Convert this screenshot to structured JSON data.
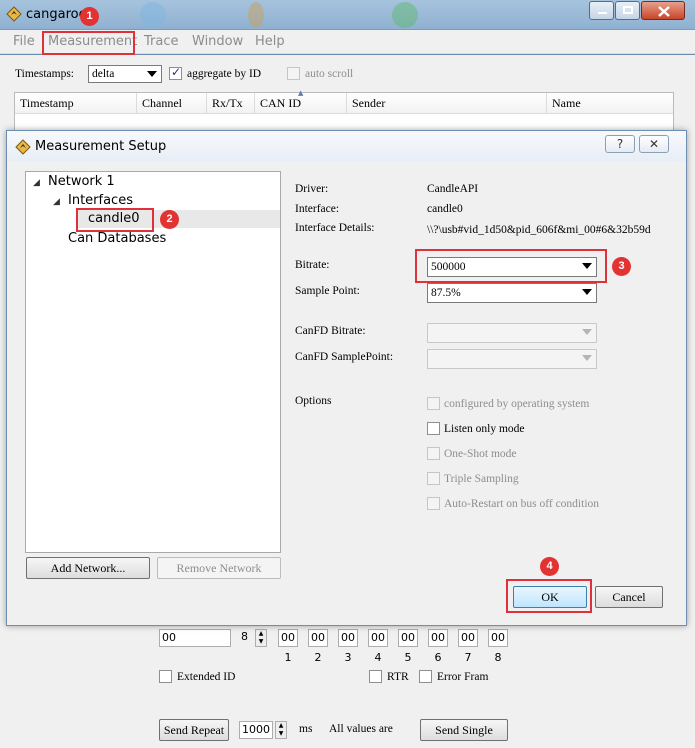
{
  "main": {
    "title": "cangaroo",
    "menu": [
      "File",
      "Measurement",
      "Trace",
      "Window",
      "Help"
    ],
    "toolbar": {
      "timestamps_label": "Timestamps:",
      "timestamps_value": "delta",
      "aggregate_label": "aggregate by ID",
      "aggregate_checked": true,
      "autoscroll_label": "auto scroll",
      "autoscroll_checked": false
    },
    "trace_columns": [
      "Timestamp",
      "Channel",
      "Rx/Tx",
      "CAN ID",
      "Sender",
      "Name"
    ]
  },
  "dialog": {
    "title": "Measurement Setup",
    "help_button": "?",
    "close_button": "✕",
    "tree": {
      "network": "Network 1",
      "interfaces": "Interfaces",
      "interface_item": "candle0",
      "can_databases": "Can Databases"
    },
    "add_network": "Add Network...",
    "remove_network": "Remove Network",
    "details": {
      "driver_label": "Driver:",
      "driver_value": "CandleAPI",
      "interface_label": "Interface:",
      "interface_value": "candle0",
      "details_label": "Interface Details:",
      "details_value": "\\\\?\\usb#vid_1d50&pid_606f&mi_00#6&32b59d",
      "bitrate_label": "Bitrate:",
      "bitrate_value": "500000",
      "sample_point_label": "Sample Point:",
      "sample_point_value": "87.5%",
      "canfd_bitrate_label": "CanFD Bitrate:",
      "canfd_samplepoint_label": "CanFD SamplePoint:",
      "options_label": "Options"
    },
    "options": [
      {
        "label": "configured by operating system",
        "checked": false,
        "enabled": false
      },
      {
        "label": "Listen only mode",
        "checked": false,
        "enabled": true
      },
      {
        "label": "One-Shot mode",
        "checked": false,
        "enabled": false
      },
      {
        "label": "Triple Sampling",
        "checked": false,
        "enabled": false
      },
      {
        "label": "Auto-Restart on bus off condition",
        "checked": false,
        "enabled": false
      }
    ],
    "ok": "OK",
    "cancel": "Cancel"
  },
  "send_panel": {
    "id_value": "00",
    "dlc_value": "8",
    "bytes": [
      "00",
      "00",
      "00",
      "00",
      "00",
      "00",
      "00",
      "00"
    ],
    "byte_numbers": [
      "1",
      "2",
      "3",
      "4",
      "5",
      "6",
      "7",
      "8"
    ],
    "extended_id": "Extended ID",
    "rtr": "RTR",
    "error_frame": "Error Fram",
    "send_repeat": "Send Repeat",
    "repeat_interval": "1000",
    "ms": "ms",
    "all_values": "All values are",
    "send_single": "Send Single"
  },
  "annotations": {
    "badges": [
      "1",
      "2",
      "3",
      "4"
    ],
    "highlight_color": "#e0303a"
  },
  "colors": {
    "titlebar": "#a6c3dd",
    "disabled_text": "#8e8e8e",
    "default_button": "#bee6fd"
  }
}
